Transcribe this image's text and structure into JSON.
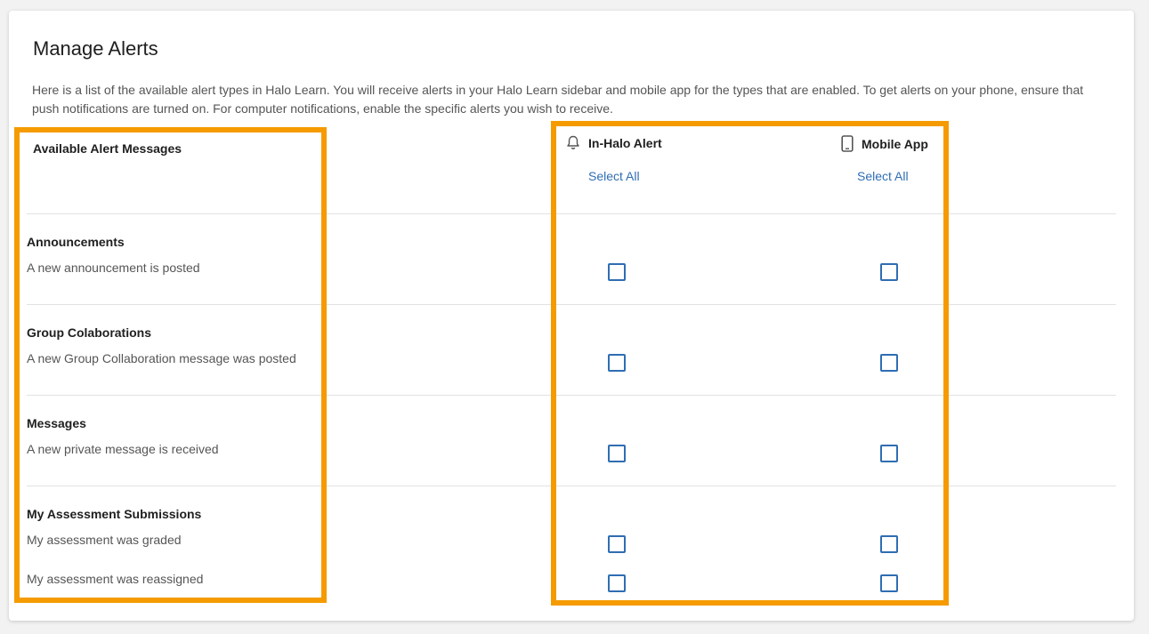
{
  "page": {
    "title": "Manage Alerts",
    "intro": "Here is a list of the available alert types in Halo Learn. You will receive alerts in your Halo Learn sidebar and mobile app for the types that are enabled. To get alerts on your phone, ensure that push notifications are turned on. For computer notifications, enable the specific alerts you wish to receive."
  },
  "table": {
    "messages_header": "Available Alert Messages",
    "channels": [
      {
        "label": "In-Halo Alert",
        "icon": "bell-icon",
        "select_all": "Select All"
      },
      {
        "label": "Mobile App",
        "icon": "phone-icon",
        "select_all": "Select All"
      }
    ],
    "categories": [
      {
        "title": "Announcements",
        "options": [
          "A new announcement is posted"
        ]
      },
      {
        "title": "Group Colaborations",
        "options": [
          "A new Group Collaboration message was posted"
        ]
      },
      {
        "title": "Messages",
        "options": [
          "A new private message is received"
        ]
      },
      {
        "title": "My Assessment Submissions",
        "options": [
          "My assessment was graded",
          "My assessment was reassigned"
        ]
      }
    ]
  },
  "colors": {
    "accent": "#2f6db3",
    "highlight": "#f59b00"
  }
}
